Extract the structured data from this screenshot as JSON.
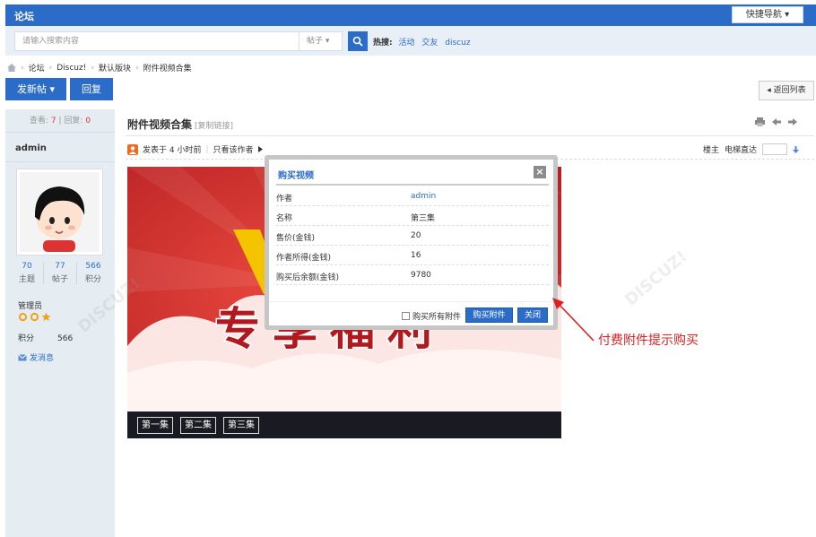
{
  "topbar": {
    "logo": "论坛",
    "quick_nav": "快捷导航 ▾"
  },
  "search": {
    "placeholder": "请输入搜索内容",
    "type": "帖子 ▾",
    "hot_label": "热搜:",
    "hot_terms": [
      "活动",
      "交友",
      "discuz"
    ]
  },
  "breadcrumb": [
    "论坛",
    "Discuz!",
    "默认版块",
    "附件视频合集"
  ],
  "actions": {
    "post": "发新帖 ▾",
    "reply": "回复",
    "back": "◂ 返回列表"
  },
  "thread": {
    "views_label": "查看:",
    "views": "7",
    "replies_label": "回复:",
    "replies": "0",
    "title": "附件视频合集",
    "copy_link": "[复制链接]",
    "posted": "发表于 4 小时前",
    "only_author": "只看该作者",
    "floor_label": "楼主",
    "elevator": "电梯直达"
  },
  "author": {
    "name": "admin",
    "counts": [
      {
        "num": "70",
        "label": "主题"
      },
      {
        "num": "77",
        "label": "帖子"
      },
      {
        "num": "566",
        "label": "积分"
      }
    ],
    "role": "管理员",
    "score_label": "积分",
    "score": "566",
    "pm": "发消息"
  },
  "poster": {
    "episodes": [
      "第一集",
      "第二集",
      "第三集"
    ],
    "accent": "#d8322e"
  },
  "modal": {
    "title": "购买视频",
    "close": "×",
    "rows": [
      {
        "key": "作者",
        "value": "admin"
      },
      {
        "key": "名称",
        "value": "第三集"
      },
      {
        "key": "售价(金钱)",
        "value": "20"
      },
      {
        "key": "作者所得(金钱)",
        "value": "16"
      },
      {
        "key": "购买后余额(金钱)",
        "value": "9780"
      }
    ],
    "buy_all": "购买所有附件",
    "buy": "购买附件",
    "close_btn": "关闭"
  },
  "annotation": "付费附件提示购买",
  "colors": {
    "brand": "#2b6cc9",
    "alert": "#e02020"
  }
}
